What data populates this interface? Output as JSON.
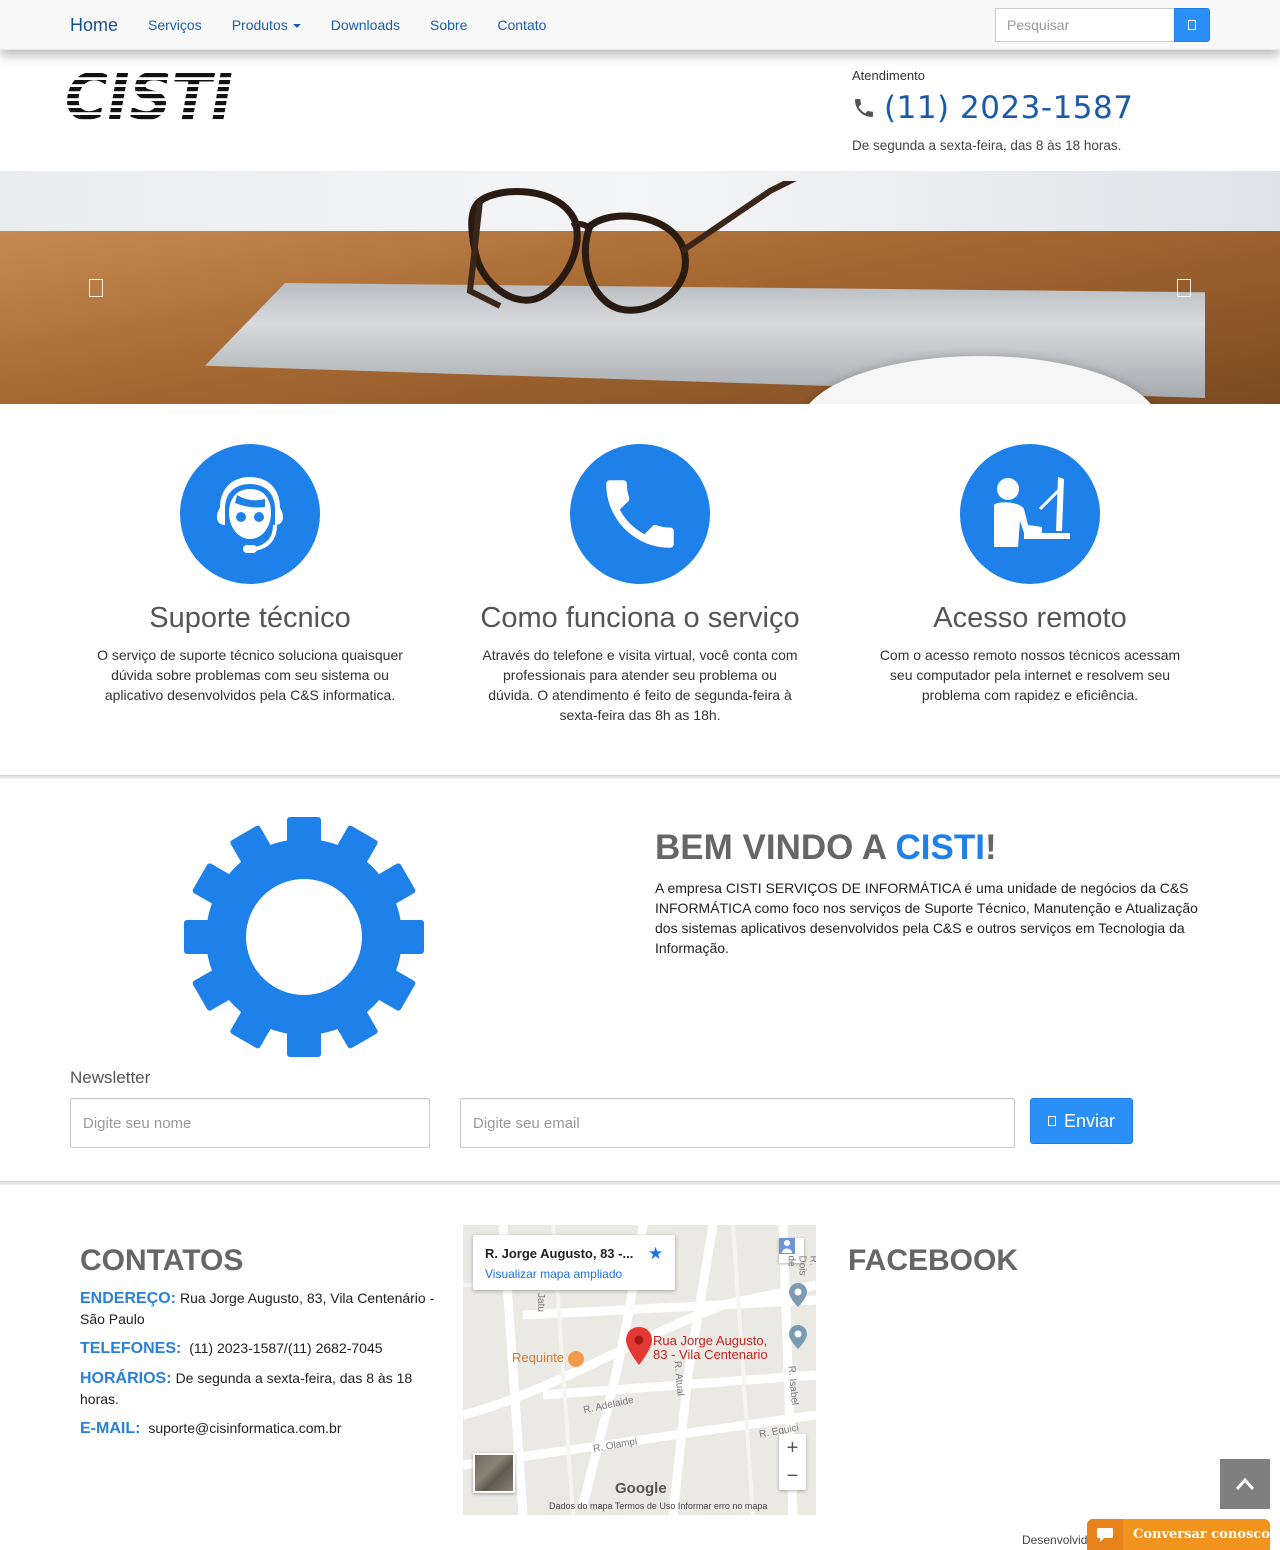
{
  "nav": {
    "items": [
      {
        "label": "Home"
      },
      {
        "label": "Serviços"
      },
      {
        "label": "Produtos"
      },
      {
        "label": "Downloads"
      },
      {
        "label": "Sobre"
      },
      {
        "label": "Contato"
      }
    ],
    "search_placeholder": "Pesquisar",
    "search_icon": "search-icon"
  },
  "header": {
    "logo_text": "CISTI",
    "atendimento_label": "Atendimento",
    "phone": "(11) 2023-1587",
    "hours": "De segunda a sexta-feira, das 8 às 18 horas."
  },
  "services": [
    {
      "title": "Suporte técnico",
      "text": "O serviço de suporte técnico soluciona quaisquer dúvida sobre problemas com seu sistema ou aplicativo desenvolvidos pela C&S informatica.",
      "icon": "support-agent-icon"
    },
    {
      "title": "Como funciona o serviço",
      "text": "Através do telefone e visita virtual, você conta com professionais para atender seu problema ou dúvida. O atendimento é feito de segunda-feira à sexta-feira das 8h as 18h.",
      "icon": "phone-icon"
    },
    {
      "title": "Acesso remoto",
      "text": "Com o acesso remoto nossos técnicos acessam seu computador pela internet e resolvem seu problema com rapidez e eficiência.",
      "icon": "computer-user-icon"
    }
  ],
  "welcome": {
    "title_prefix": "BEM VINDO A ",
    "title_accent": "CISTI",
    "title_suffix": "!",
    "text": "A empresa CISTI SERVIÇOS DE INFORMÁTICA é uma unidade de negócios da C&S INFORMÁTICA como foco nos serviços de Suporte Técnico, Manutenção e Atualização dos sistemas aplicativos desenvolvidos pela C&S e outros serviços em Tecnologia da Informação."
  },
  "newsletter": {
    "label": "Newsletter",
    "name_placeholder": "Digite seu nome",
    "email_placeholder": "Digite seu email",
    "button_label": "Enviar"
  },
  "contacts": {
    "title": "CONTATOS",
    "address_key": "ENDEREÇO:",
    "address": "Rua Jorge Augusto, 83, Vila Centenário - São Paulo",
    "phones_key": "TELEFONES:",
    "phones": "(11) 2023-1587/(11) 2682-7045",
    "hours_key": "HORÁRIOS:",
    "hours": "De segunda a sexta-feira, das 8 às 18 horas.",
    "email_key": "E-MAIL:",
    "email": "suporte@cisinformatica.com.br"
  },
  "map": {
    "card_title": "R. Jorge Augusto, 83 -...",
    "card_link": "Visualizar mapa ampliado",
    "pin_label_1": "Rua Jorge Augusto,",
    "pin_label_2": "83 - Vila Centenario",
    "place_requinte": "Requinte",
    "streets": [
      "R. Adelaide",
      "R. Olampi",
      "R. Atual",
      "R. Isabel",
      "R. Equici",
      "Jatu",
      "R. Dois de"
    ],
    "google": "Google",
    "footer": "Dados do mapa    Termos de Uso    Informar erro no mapa",
    "zoom_in": "+",
    "zoom_out": "−"
  },
  "facebook": {
    "title": "FACEBOOK"
  },
  "footer": {
    "text": "Desenvolvid"
  },
  "chat": {
    "label": "Conversar conosco"
  },
  "colors": {
    "accent": "#1e80e9",
    "button": "#2a8ff7",
    "chat": "#f0941d"
  }
}
